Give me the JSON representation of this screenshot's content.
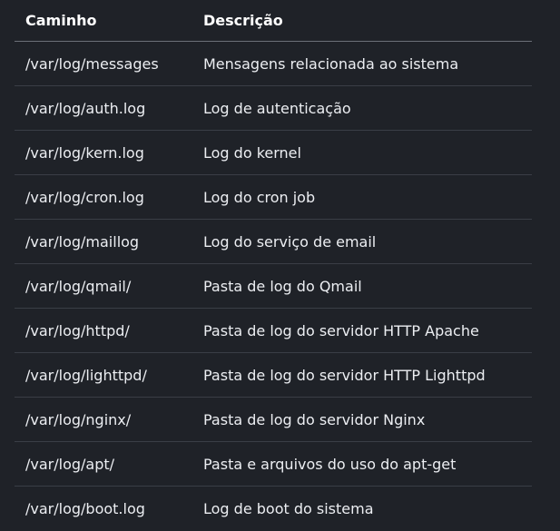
{
  "table": {
    "headers": {
      "path": "Caminho",
      "description": "Descrição"
    },
    "rows": [
      {
        "path": "/var/log/messages",
        "description": "Mensagens relacionada ao sistema"
      },
      {
        "path": "/var/log/auth.log",
        "description": "Log de autenticação"
      },
      {
        "path": "/var/log/kern.log",
        "description": "Log do kernel"
      },
      {
        "path": "/var/log/cron.log",
        "description": "Log do cron job"
      },
      {
        "path": "/var/log/maillog",
        "description": "Log do serviço de email"
      },
      {
        "path": "/var/log/qmail/",
        "description": "Pasta de log do Qmail"
      },
      {
        "path": "/var/log/httpd/",
        "description": "Pasta de log do servidor HTTP Apache"
      },
      {
        "path": "/var/log/lighttpd/",
        "description": "Pasta de log do servidor HTTP Lighttpd"
      },
      {
        "path": "/var/log/nginx/",
        "description": "Pasta de log do servidor Nginx"
      },
      {
        "path": "/var/log/apt/",
        "description": "Pasta e arquivos do uso do apt-get"
      },
      {
        "path": "/var/log/boot.log",
        "description": "Log de boot do sistema"
      }
    ]
  }
}
